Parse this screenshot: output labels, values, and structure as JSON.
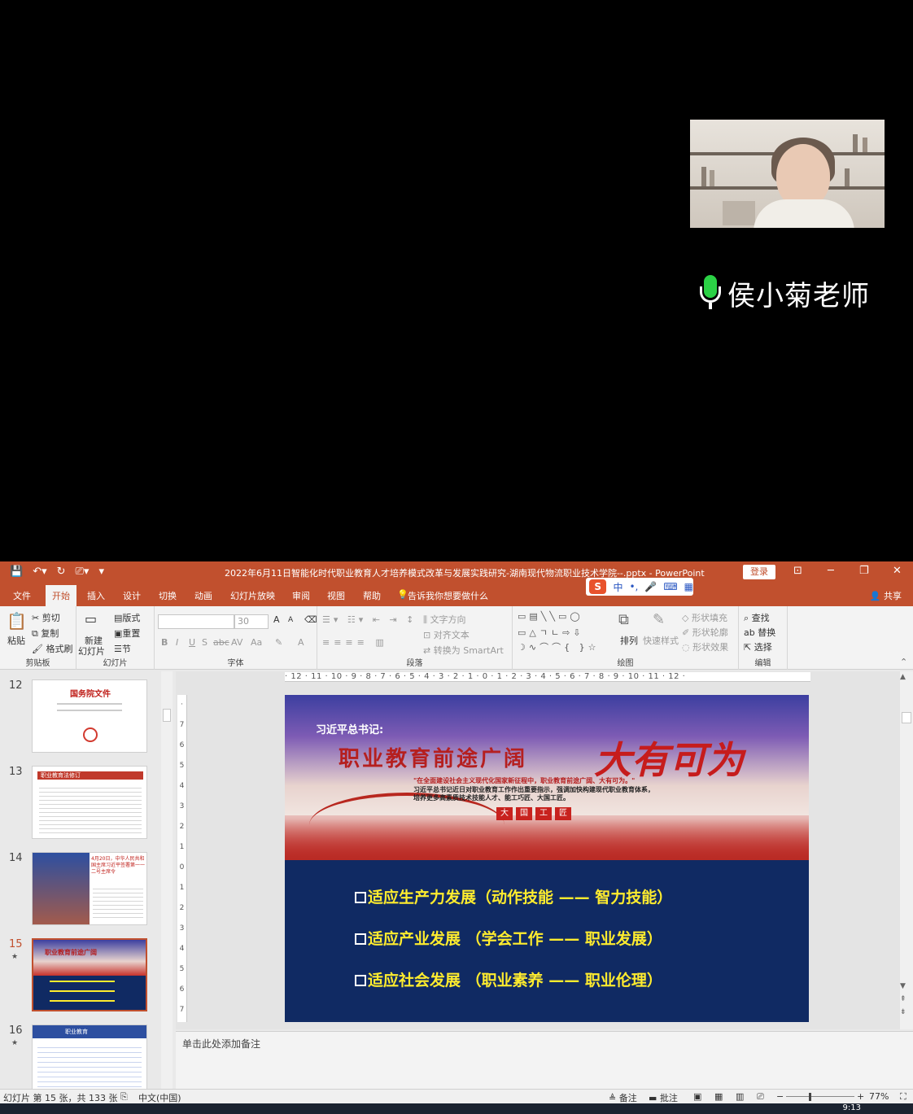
{
  "meeting": {
    "speaker_name": "侯小菊老师"
  },
  "titlebar": {
    "document_title": "2022年6月11日智能化时代职业教育人才培养模式改革与发展实践研究-湖南现代物流职业技术学院--.pptx  -  PowerPoint",
    "login_label": "登录",
    "minimize": "─",
    "restore": "❐",
    "close": "✕",
    "ribbon_display": "⊡"
  },
  "ime": {
    "logo": "S",
    "mode": "中",
    "punct": "•,",
    "mic": "🎤",
    "keyboard": "⌨",
    "grid": "▦"
  },
  "tabs": {
    "items": [
      "文件",
      "开始",
      "插入",
      "设计",
      "切换",
      "动画",
      "幻灯片放映",
      "审阅",
      "视图",
      "帮助"
    ],
    "tell_me": "告诉我你想要做什么",
    "share": "共享"
  },
  "ribbon": {
    "clipboard": {
      "paste": "粘贴",
      "cut": "剪切",
      "copy": "复制",
      "format_painter": "格式刷",
      "group": "剪贴板"
    },
    "slides": {
      "new_slide_1": "新建",
      "new_slide_2": "幻灯片",
      "layout": "版式",
      "reset": "重置",
      "section": "节",
      "group": "幻灯片"
    },
    "font": {
      "font_size": "30",
      "bold": "B",
      "italic": "I",
      "underline": "U",
      "shadow": "S",
      "strike": "abc",
      "spacing": "AV",
      "case": "Aa",
      "grow": "A",
      "shrink": "A",
      "group": "字体"
    },
    "paragraph": {
      "text_direction": "文字方向",
      "align_text": "对齐文本",
      "smartart": "转换为 SmartArt",
      "group": "段落"
    },
    "drawing": {
      "arrange": "排列",
      "quick_styles": "快速样式",
      "shape_fill": "形状填充",
      "shape_outline": "形状轮廓",
      "shape_effects": "形状效果",
      "group": "绘图"
    },
    "editing": {
      "find": "查找",
      "replace": "替换",
      "select": "选择",
      "group": "编辑"
    }
  },
  "thumbnails": [
    {
      "number": "12",
      "star": "",
      "title": "国务院文件"
    },
    {
      "number": "13",
      "star": "",
      "title": "职业教育法修订"
    },
    {
      "number": "14",
      "star": "",
      "title": "4月20日，中华人民共和国主席习近平签署第一一二号主席令"
    },
    {
      "number": "15",
      "star": "★",
      "title": "职业教育前途广阔"
    },
    {
      "number": "16",
      "star": "★",
      "title": "职业教育"
    }
  ],
  "ruler": {
    "horizontal": "· 12 · 11 · 10 · 9 · 8 · 7 · 6 · 5 · 4 · 3 · 2 · 1 · 0 · 1 · 2 · 3 · 4 · 5 · 6 · 7 · 8 · 9 · 10 · 11 · 12 ·"
  },
  "slide": {
    "quote_label": "习近平总书记:",
    "headline": "职业教育前途广阔",
    "calligraphy": "大有可为",
    "sub_line_1": "\"在全面建设社会主义现代化国家新征程中，职业教育前途广阔、大有可为。\"",
    "sub_line_2": "习近平总书记近日对职业教育工作作出重要指示，强调加快构建现代职业教育体系，",
    "sub_line_3": "培养更多高素质技术技能人才、能工巧匠、大国工匠。",
    "seals": [
      "大",
      "国",
      "工",
      "匠"
    ],
    "bullets": [
      "适应生产力发展（动作技能 —— 智力技能）",
      "适应产业发展   （学会工作 —— 职业发展）",
      "适应社会发展   （职业素养 —— 职业伦理）"
    ]
  },
  "notes": {
    "placeholder": "单击此处添加备注"
  },
  "status": {
    "slide_info": "幻灯片 第 15 张，共 133 张",
    "language": "中文(中国)",
    "notes": "备注",
    "comments": "批注",
    "zoom": "77%"
  },
  "taskbar": {
    "clock": "9:13"
  }
}
